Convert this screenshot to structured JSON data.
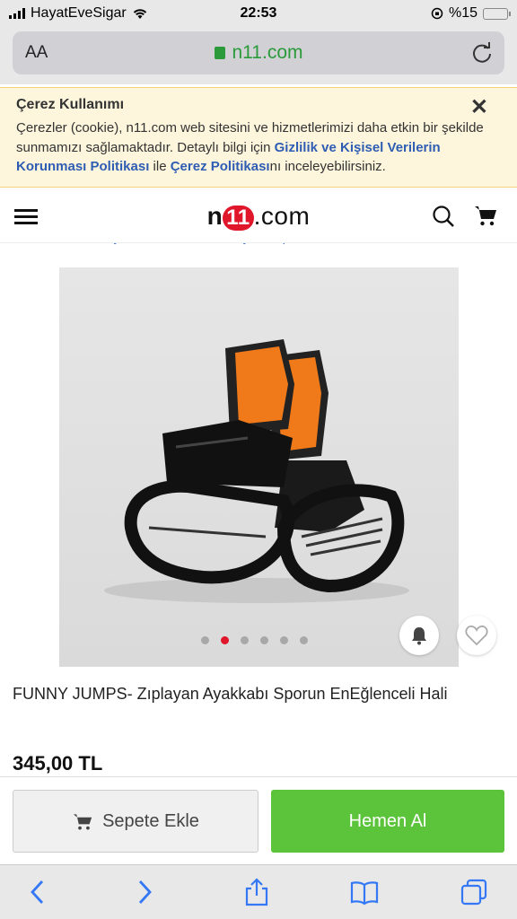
{
  "status_bar": {
    "carrier": "HayatEveSigar",
    "time": "22:53",
    "battery_percent": "%15",
    "battery_level": 0.15
  },
  "browser": {
    "aa_label": "AA",
    "domain": "n11.com"
  },
  "cookie_banner": {
    "title": "Çerez Kullanımı",
    "text_part1": "Çerezler (cookie), n11.com web sitesini ve hizmetlerimizi daha etkin bir şekilde sunmamızı sağlamaktadır. Detaylı bilgi için ",
    "link1": "Gizlilik ve Kişisel Verilerin Korunması Politikası",
    "text_part2": " ile ",
    "link2": "Çerez Politikası",
    "text_part3": "nı inceleyebilirsiniz.",
    "close_label": "✕"
  },
  "header": {
    "logo_n": "n",
    "logo_ones": "11",
    "logo_com": ".com"
  },
  "breadcrumb": [
    "Fitness & Kondisyon",
    "Fitness & Kardiyo",
    "Spor TV Ürünleri"
  ],
  "gallery": {
    "dot_count": 6,
    "active_index": 1
  },
  "product": {
    "title": "FUNNY JUMPS- Zıplayan Ayakkabı Sporun EnEğlenceli Hali",
    "price": "345,00 TL"
  },
  "actions": {
    "add_to_cart": "Sepete Ekle",
    "buy_now": "Hemen Al"
  },
  "colors": {
    "brand_red": "#e0162b",
    "buy_green": "#5cc43a",
    "link_blue": "#2f5db3",
    "secure_green": "#2a9a3a"
  }
}
